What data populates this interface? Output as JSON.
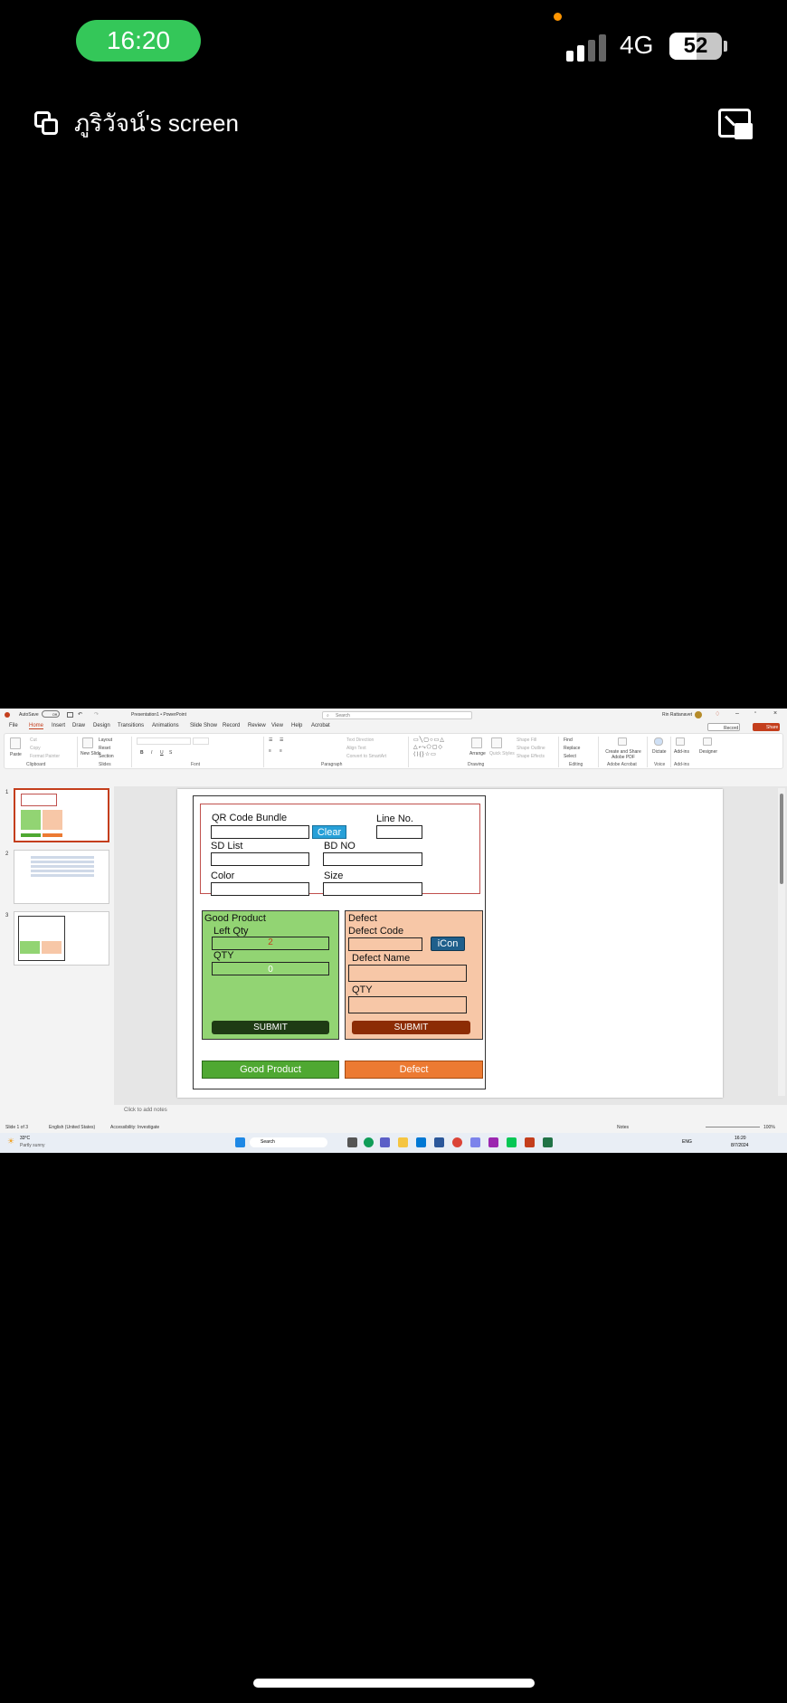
{
  "status_bar": {
    "time": "16:20",
    "network": "4G",
    "battery": "52",
    "battery_level_percent": 52
  },
  "screen_share": {
    "title": "ภูริวัจน์'s screen"
  },
  "powerpoint": {
    "title": "Presentation1 • PowerPoint",
    "search_placeholder": "Search",
    "user_name": "Rin Rattanavet",
    "autosave": "AutoSave",
    "autosave_state": "Off",
    "menu": [
      "File",
      "Home",
      "Insert",
      "Draw",
      "Design",
      "Transitions",
      "Animations",
      "Slide Show",
      "Record",
      "Review",
      "View",
      "Help",
      "Acrobat"
    ],
    "record_label": "Record",
    "share_label": "Share",
    "ribbon_groups": [
      "Clipboard",
      "Slides",
      "Font",
      "Paragraph",
      "Drawing",
      "Editing",
      "Adobe Acrobat",
      "Voice",
      "Add-ins"
    ],
    "ribbon_labels": {
      "paste": "Paste",
      "cut": "Cut",
      "copy": "Copy",
      "format_painter": "Format Painter",
      "new_slide": "New Slide",
      "layout": "Layout",
      "reset": "Reset",
      "section": "Section",
      "arrange": "Arrange",
      "quick_styles": "Quick Styles",
      "shape_fill": "Shape Fill",
      "shape_outline": "Shape Outline",
      "shape_effects": "Shape Effects",
      "find": "Find",
      "replace": "Replace",
      "select": "Select",
      "create_share_pdf": "Create and Share Adobe PDF",
      "dictate": "Dictate",
      "add_ins": "Add-ins",
      "designer": "Designer",
      "text_direction": "Text Direction",
      "align_text": "Align Text",
      "convert_smartart": "Convert to SmartArt"
    },
    "slide_numbers": [
      "1",
      "2",
      "3"
    ],
    "notes_placeholder": "Click to add notes",
    "status": {
      "slide": "Slide 1 of 3",
      "language": "English (United States)",
      "accessibility": "Accessibility: Investigate",
      "notes": "Notes",
      "zoom": "100%"
    },
    "taskbar": {
      "weather_temp": "33°C",
      "weather_desc": "Partly sunny",
      "search": "Search",
      "lang": "ENG",
      "time": "16:20",
      "date": "8/7/2024"
    }
  },
  "slide": {
    "qr_code_label": "QR Code Bundle",
    "clear_button": "Clear",
    "line_no_label": "Line No.",
    "sd_list_label": "SD List",
    "bd_no_label": "BD NO",
    "color_label": "Color",
    "size_label": "Size",
    "good_product": {
      "title": "Good Product",
      "left_qty_label": "Left Qty",
      "left_qty_value": "2",
      "qty_label": "QTY",
      "qty_value": "0",
      "submit": "SUBMIT"
    },
    "defect": {
      "title": "Defect",
      "defect_code_label": "Defect Code",
      "icon_button": "iCon",
      "defect_name_label": "Defect Name",
      "qty_label": "QTY",
      "submit": "SUBMIT"
    },
    "good_product_button": "Good Product",
    "defect_button": "Defect"
  },
  "colors": {
    "accent_green": "#34c759",
    "ppt_orange": "#c43e1c",
    "good_bg": "#92d473",
    "defect_bg": "#f7c7a7"
  }
}
